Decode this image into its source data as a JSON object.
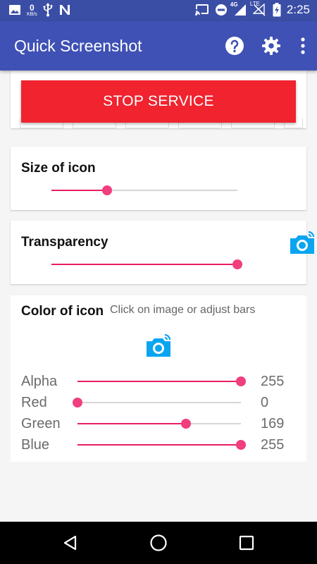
{
  "status_bar": {
    "data_rate_value": "0",
    "data_rate_unit": "KB/s",
    "network_type": "4G",
    "network_label": "LTE",
    "time": "2:25",
    "icons": [
      "image-icon",
      "usb-icon",
      "n-icon",
      "cast-icon",
      "dnd-icon",
      "signal-icon",
      "wifi-off-icon",
      "battery-icon"
    ]
  },
  "app_bar": {
    "title": "Quick Screenshot",
    "actions": [
      "help-icon",
      "settings-icon",
      "more-icon"
    ]
  },
  "service": {
    "button_label": "STOP SERVICE",
    "button_color": "#f0232f"
  },
  "size_card": {
    "title": "Size of icon",
    "level": 0.3
  },
  "transparency_card": {
    "title": "Transparency",
    "level": 1.0
  },
  "color_card": {
    "title": "Color of icon",
    "hint": "Click on image or adjust bars",
    "icon_color": "#0aa5f0",
    "channels": [
      {
        "label": "Alpha",
        "value": "255",
        "level": 1.0
      },
      {
        "label": "Red",
        "value": "0",
        "level": 0.0
      },
      {
        "label": "Green",
        "value": "169",
        "level": 0.663
      },
      {
        "label": "Blue",
        "value": "255",
        "level": 1.0
      }
    ]
  },
  "colors": {
    "primary": "#3f51b5",
    "primary_dark": "#3b4ea5",
    "accent": "#e91e63"
  }
}
